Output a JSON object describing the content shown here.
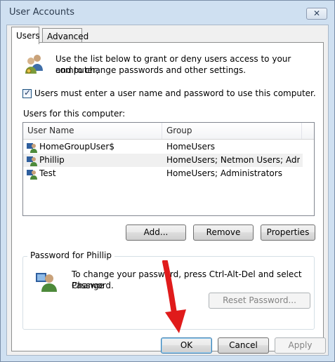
{
  "window": {
    "title": "User Accounts",
    "close_glyph": "✕"
  },
  "tabs": [
    {
      "label": "Users",
      "active": true
    },
    {
      "label": "Advanced",
      "active": false
    }
  ],
  "intro": {
    "line1": "Use the list below to grant or deny users access to your computer,",
    "line2": "and to change passwords and other settings."
  },
  "require_login": {
    "label": "Users must enter a user name and password to use this computer.",
    "checked": true
  },
  "users_section_label": "Users for this computer:",
  "users_table": {
    "columns": [
      "User Name",
      "Group"
    ],
    "rows": [
      {
        "name": "HomeGroupUser$",
        "group": "HomeUsers",
        "highlighted": false
      },
      {
        "name": "Phillip",
        "group": "HomeUsers; Netmon Users; Admi...",
        "highlighted": true
      },
      {
        "name": "Test",
        "group": "HomeUsers; Administrators",
        "highlighted": false
      }
    ]
  },
  "buttons": {
    "add": "Add...",
    "remove": "Remove",
    "properties": "Properties"
  },
  "password_group": {
    "legend": "Password for Phillip",
    "line1": "To change your password, press Ctrl-Alt-Del and select Change",
    "line2": "Password.",
    "reset_label": "Reset Password..."
  },
  "footer": {
    "ok": "OK",
    "cancel": "Cancel",
    "apply": "Apply"
  },
  "colors": {
    "accent_arrow": "#e01b1b",
    "legend_text": "#1e3287",
    "row_highlight": "#f0f0f0"
  },
  "icons": [
    "users-icon",
    "user-icon",
    "close-icon",
    "checkbox-check-icon",
    "down-arrow-annotation"
  ]
}
